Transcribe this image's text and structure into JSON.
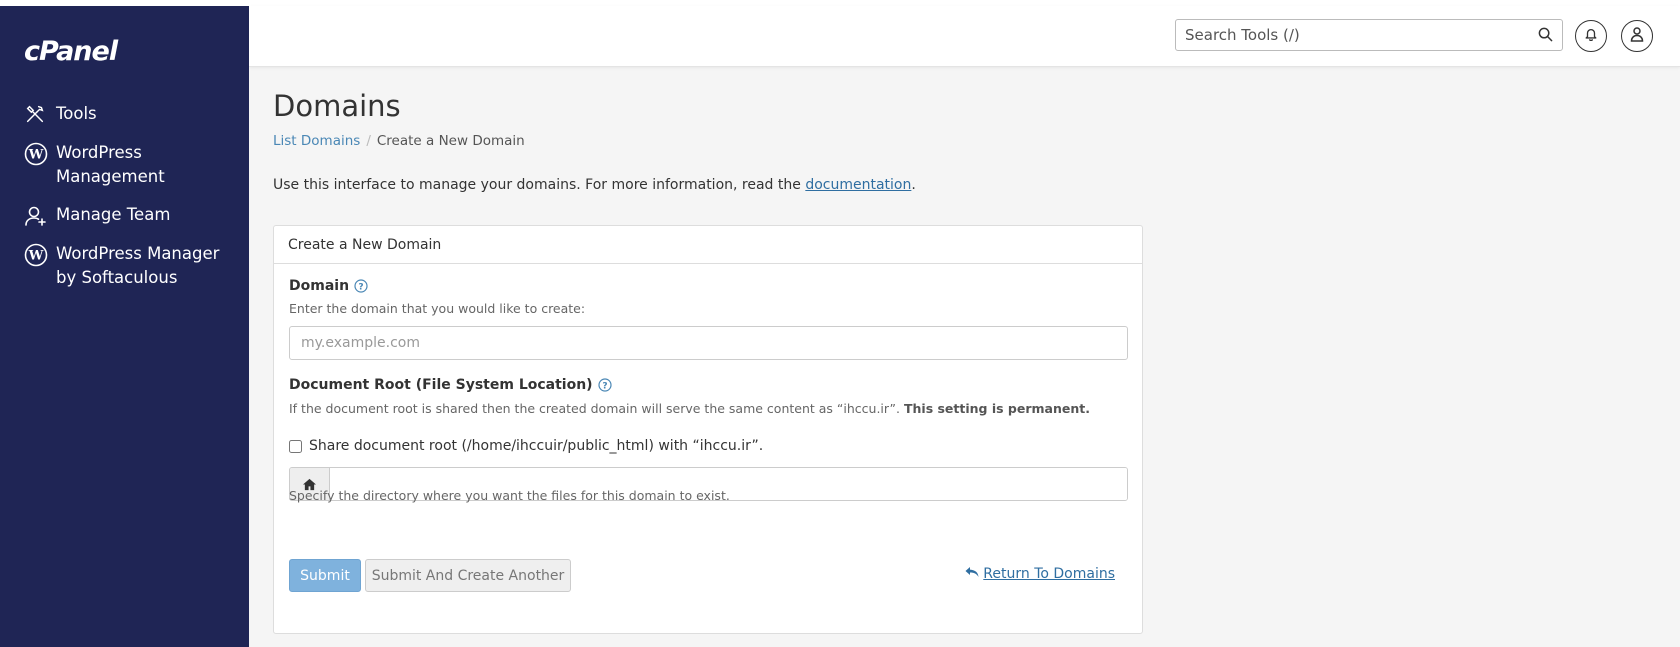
{
  "brand": {
    "logo_text": "cPanel"
  },
  "sidebar": {
    "items": [
      {
        "label": "Tools",
        "icon": "tools-icon"
      },
      {
        "label": "WordPress\nManagement",
        "icon": "wordpress-icon"
      },
      {
        "label": "Manage Team",
        "icon": "add-user-icon"
      },
      {
        "label": "WordPress Manager\nby Softaculous",
        "icon": "wordpress-icon"
      }
    ]
  },
  "header": {
    "search_placeholder": "Search Tools (/)",
    "icons": [
      "search-icon",
      "bell-icon",
      "user-icon"
    ]
  },
  "page": {
    "title": "Domains",
    "breadcrumb": {
      "link": "List Domains",
      "current": "Create a New Domain"
    },
    "intro_text": "Use this interface to manage your domains. For more information, read the ",
    "intro_link": "documentation",
    "intro_end": "."
  },
  "form": {
    "panel_title": "Create a New Domain",
    "domain_label": "Domain",
    "domain_help": "Enter the domain that you would like to create:",
    "domain_placeholder": "my.example.com",
    "docroot_label": "Document Root (File System Location)",
    "docroot_help": "If the document root is shared then the created domain will serve the same content as “ihccu.ir”. ",
    "docroot_help_bold": "This setting is permanent.",
    "share_checkbox_label": "Share document root (/home/ihccuir/public_html) with “ihccu.ir”.",
    "share_checked": false,
    "docroot_value": "",
    "docroot_hint": "Specify the directory where you want the files for this domain to exist.",
    "submit_label": "Submit",
    "submit_another_label": "Submit And Create Another",
    "return_label": "Return To Domains"
  },
  "colors": {
    "sidebar_bg": "#1f2555",
    "link": "#2f6ea1",
    "submit_bg": "#7fb2dd"
  }
}
